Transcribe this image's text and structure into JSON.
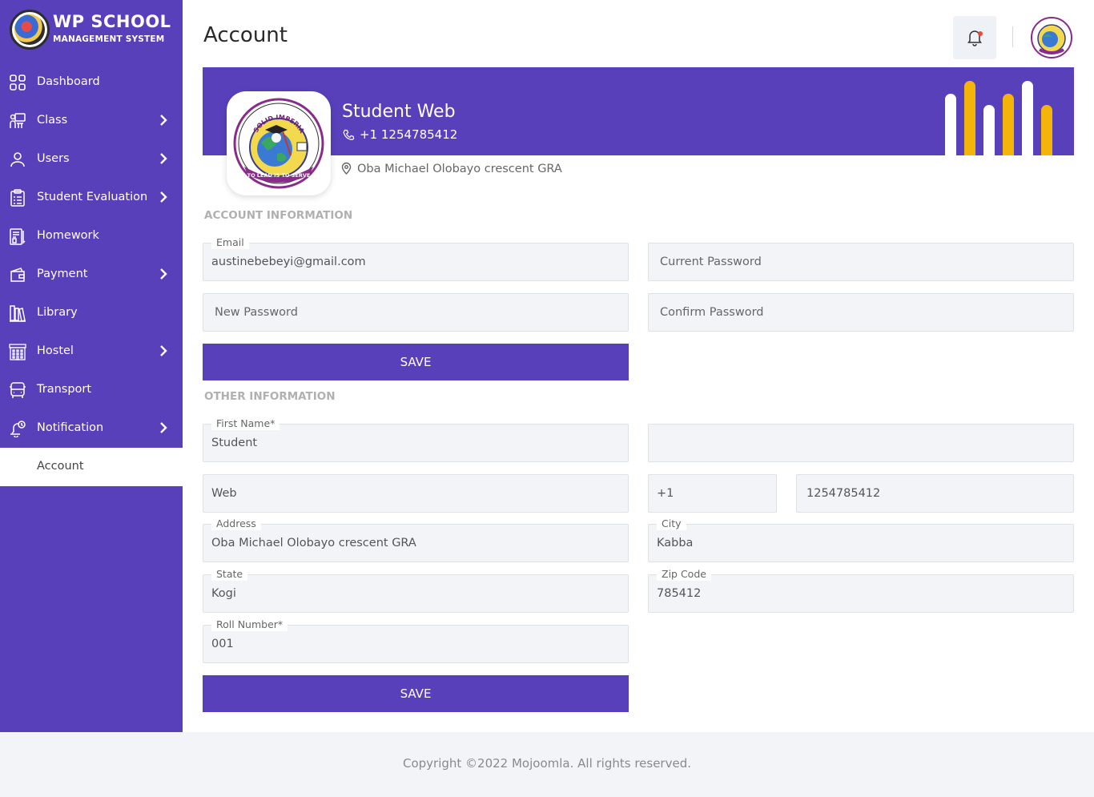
{
  "brand": {
    "title": "WP SCHOOL",
    "subtitle": "MANAGEMENT SYSTEM"
  },
  "sidebar": {
    "items": [
      {
        "label": "Dashboard",
        "icon": "grid-icon",
        "has_children": false
      },
      {
        "label": "Class",
        "icon": "classroom-icon",
        "has_children": true
      },
      {
        "label": "Users",
        "icon": "user-icon",
        "has_children": true
      },
      {
        "label": "Student Evaluation",
        "icon": "clipboard-icon",
        "has_children": true
      },
      {
        "label": "Homework",
        "icon": "homework-icon",
        "has_children": false
      },
      {
        "label": "Payment",
        "icon": "wallet-icon",
        "has_children": true
      },
      {
        "label": "Library",
        "icon": "library-icon",
        "has_children": false
      },
      {
        "label": "Hostel",
        "icon": "hostel-icon",
        "has_children": true
      },
      {
        "label": "Transport",
        "icon": "bus-icon",
        "has_children": false
      },
      {
        "label": "Notification",
        "icon": "notification-icon",
        "has_children": true
      },
      {
        "label": "Account",
        "icon": "",
        "has_children": false,
        "active": true
      }
    ]
  },
  "header": {
    "title": "Account"
  },
  "profile": {
    "name": "Student Web",
    "phone": "+1  1254785412",
    "address": "Oba Michael Olobayo crescent GRA",
    "seal_text_top": "SOLID IMPERIAL COLLEGE INTL",
    "seal_text_bottom": "TO LEAD IS TO SERVE"
  },
  "account_info": {
    "section_title": "ACCOUNT INFORMATION",
    "email_label": "Email",
    "email_value": "austinebebeyi@gmail.com",
    "current_password_placeholder": "Current Password",
    "new_password_placeholder": "New Password",
    "confirm_password_placeholder": "Confirm Password",
    "save_label": "SAVE"
  },
  "other_info": {
    "section_title": "OTHER INFORMATION",
    "first_name_label": "First Name*",
    "first_name_value": "Student",
    "middle_name_value": "",
    "last_name_value": "Web",
    "country_code_value": "+1",
    "phone_value": "1254785412",
    "address_label": "Address",
    "address_value": "Oba Michael Olobayo crescent GRA",
    "city_label": "City",
    "city_value": "Kabba",
    "state_label": "State",
    "state_value": "Kogi",
    "zip_label": "Zip Code",
    "zip_value": "785412",
    "roll_label": "Roll Number*",
    "roll_value": "001",
    "save_label": "SAVE"
  },
  "footer": {
    "text": "Copyright ©2022 Mojoomla. All rights reserved."
  },
  "colors": {
    "primary": "#5840bb",
    "accent_yellow": "#f5b40a",
    "notification_dot": "#e74c3c"
  }
}
